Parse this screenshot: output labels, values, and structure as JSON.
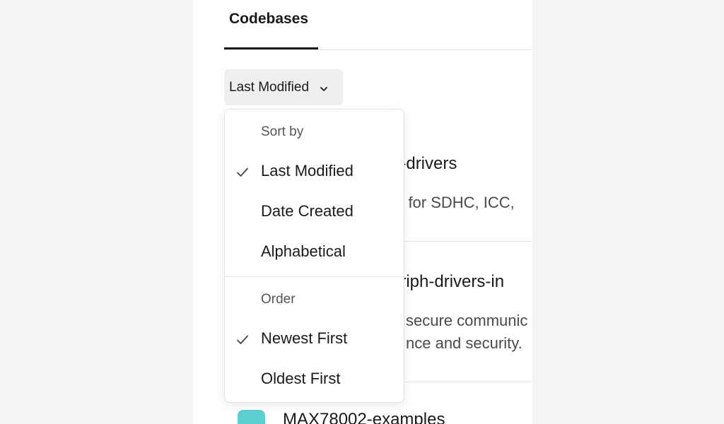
{
  "tabs": {
    "active_label": "Codebases"
  },
  "sort_button": {
    "label": "Last Modified",
    "icon": "chevron-down-icon"
  },
  "items": [
    {
      "title_visible": "n-drivers",
      "desc_line1": "rs for SDHC, ICC,"
    },
    {
      "title_visible": "eriph-drivers-in",
      "desc_line1": "secure communic",
      "desc_line2": "nce and security."
    },
    {
      "title_visible": "MAX78002-examples",
      "icon_color": "#5ccfd2"
    }
  ],
  "sort_menu": {
    "sort_heading": "Sort by",
    "sort_options": [
      {
        "label": "Last Modified",
        "selected": true
      },
      {
        "label": "Date Created",
        "selected": false
      },
      {
        "label": "Alphabetical",
        "selected": false
      }
    ],
    "order_heading": "Order",
    "order_options": [
      {
        "label": "Newest First",
        "selected": true
      },
      {
        "label": "Oldest First",
        "selected": false
      }
    ]
  }
}
